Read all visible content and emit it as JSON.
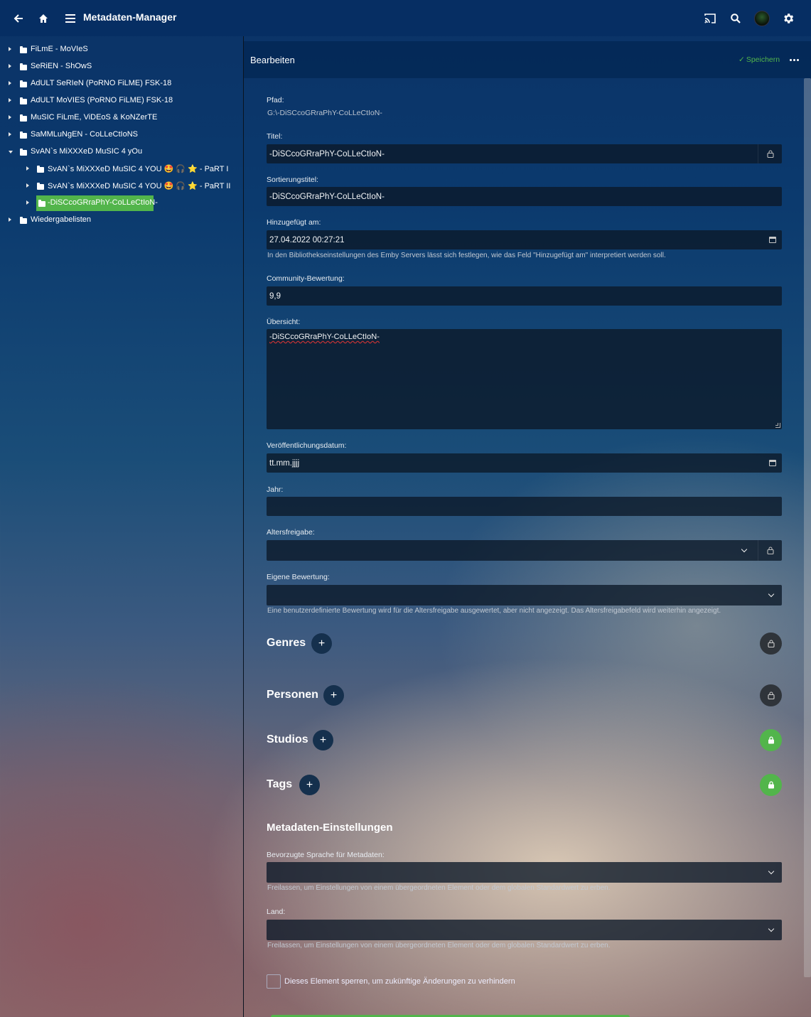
{
  "header": {
    "title": "Metadaten-Manager",
    "icons": [
      "arrow-back-icon",
      "home-icon",
      "menu-icon",
      "cast-icon",
      "search-icon",
      "avatar",
      "gear-icon"
    ]
  },
  "tree": [
    {
      "label": "FiLmE - MoVIeS",
      "expanded": false
    },
    {
      "label": "SeRiEN - ShOwS",
      "expanded": false
    },
    {
      "label": "AdULT SeRIeN (PoRNO FiLME) FSK-18",
      "expanded": false
    },
    {
      "label": "AdULT MoVIES (PoRNO FiLME) FSK-18",
      "expanded": false
    },
    {
      "label": "MuSIC FiLmE, ViDEoS & KoNZerTE",
      "expanded": false
    },
    {
      "label": "SaMMLuNgEN - CoLLeCtIoNS",
      "expanded": false
    },
    {
      "label": "SvAN`s MiXXXeD MuSIC 4 yOu",
      "expanded": true,
      "children": [
        {
          "label": "SvAN`s MiXXXeD MuSIC 4 YOU 🤩 🎧 ⭐ - PaRT I"
        },
        {
          "label": "SvAN`s MiXXXeD MuSIC 4 YOU 🤩 🎧 ⭐ - PaRT II"
        },
        {
          "label": "-DiSCcoGRraPhY-CoLLeCtIoN-",
          "selected": true
        }
      ]
    },
    {
      "label": "Wiedergabelisten",
      "expanded": false
    }
  ],
  "panel": {
    "title": "Bearbeiten",
    "save_label": "Speichern",
    "save_check": "✓"
  },
  "form": {
    "path_label": "Pfad:",
    "path_value": "G:\\-DiSCcoGRraPhY-CoLLeCtIoN-",
    "title_label": "Titel:",
    "title_value": "-DiSCcoGRraPhY-CoLLeCtIoN-",
    "sort_title_label": "Sortierungstitel:",
    "sort_title_value": "-DiSCcoGRraPhY-CoLLeCtIoN-",
    "added_label": "Hinzugefügt am:",
    "added_value": "27.04.2022 00:27:21",
    "added_hint": "In den Bibliothekseinstellungen des Emby Servers lässt sich festlegen, wie das Feld \"Hinzugefügt am\" interpretiert werden soll.",
    "community_label": "Community-Bewertung:",
    "community_value": "9,9",
    "overview_label": "Übersicht:",
    "overview_value": "-DiSCcoGRraPhY-CoLLeCtIoN-",
    "release_label": "Veröffentlichungsdatum:",
    "release_value": "tt.mm.jjjj",
    "year_label": "Jahr:",
    "year_value": "",
    "rating_label": "Altersfreigabe:",
    "rating_value": "",
    "custom_rating_label": "Eigene Bewertung:",
    "custom_rating_value": "",
    "custom_rating_hint": "Eine benutzerdefinierte Bewertung wird für die Altersfreigabe ausgewertet, aber nicht angezeigt. Das Altersfreigabefeld wird weiterhin angezeigt."
  },
  "sections": [
    {
      "title": "Genres",
      "add": "+",
      "locked": false
    },
    {
      "title": "Personen",
      "add": "+",
      "locked": false
    },
    {
      "title": "Studios",
      "add": "+",
      "locked": true
    },
    {
      "title": "Tags",
      "add": "+",
      "locked": true
    }
  ],
  "metadata_settings": {
    "heading": "Metadaten-Einstellungen",
    "language_label": "Bevorzugte Sprache für Metadaten:",
    "language_value": "",
    "language_hint": "Freilassen, um Einstellungen von einem übergeordneten Element oder dem globalen Standardwert zu erben.",
    "country_label": "Land:",
    "country_value": "",
    "country_hint": "Freilassen, um Einstellungen von einem übergeordneten Element oder dem globalen Standardwert zu erben.",
    "lock_label": "Dieses Element sperren, um zukünftige Änderungen zu verhindern"
  },
  "colors": {
    "topbar": "#062e63",
    "accent": "#52b54b"
  }
}
